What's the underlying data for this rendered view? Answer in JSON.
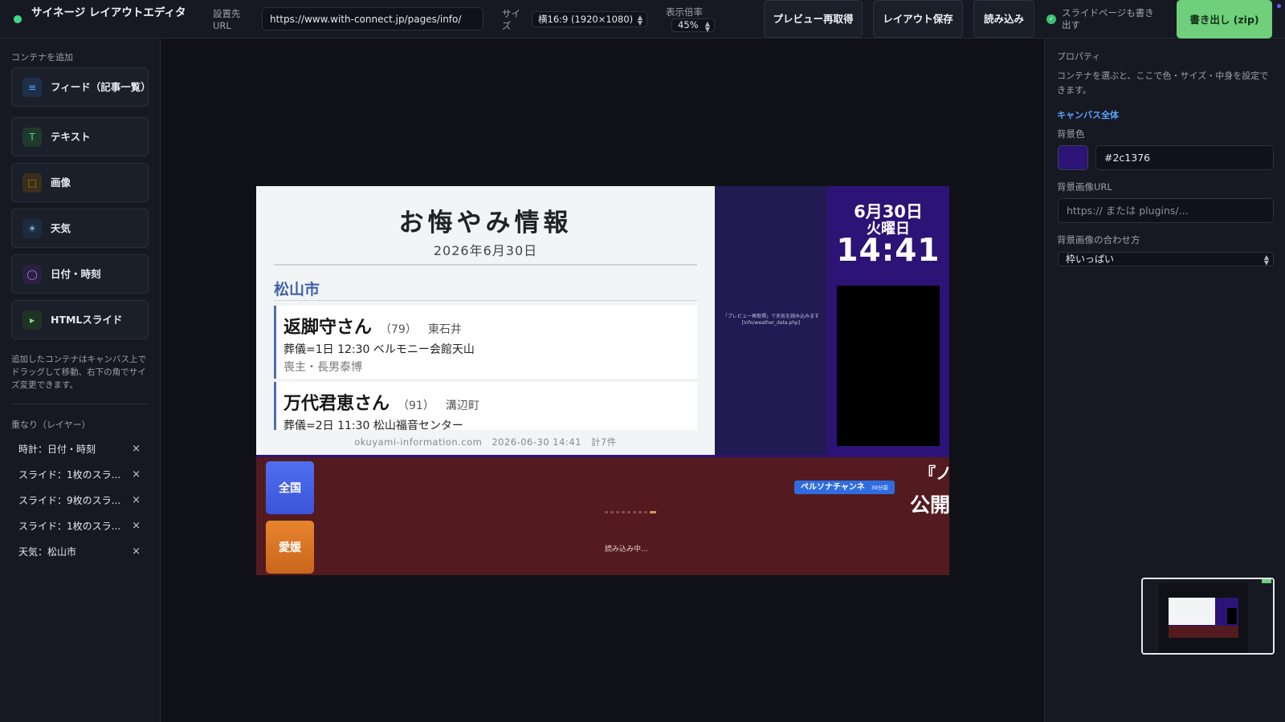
{
  "app": {
    "title": "サイネージ レイアウトエディタ"
  },
  "toolbar": {
    "url_label": "設置先URL",
    "url_value": "https://www.with-connect.jp/pages/info/",
    "size_label": "サイズ",
    "size_value": "横16:9 (1920×1080)",
    "zoom_label": "表示倍率",
    "zoom_value": "45%",
    "preview_button": "プレビュー再取得",
    "save_button": "レイアウト保存",
    "load_button": "読み込み",
    "slide_export_checkbox": "スライドページも書き出す",
    "slide_export_checked": true,
    "export_button": "書き出し (zip)"
  },
  "sidebar": {
    "add_title": "コンテナを追加",
    "add_items": [
      {
        "label": "フィード（記事一覧）",
        "icon": "list-icon",
        "glyph": "≡",
        "color": "#5aa3ff",
        "bg": "#1f2f4a"
      },
      {
        "label": "テキスト",
        "icon": "text-icon",
        "glyph": "T",
        "color": "#5cd08a",
        "bg": "#1d3a2a"
      },
      {
        "label": "画像",
        "icon": "image-icon",
        "glyph": "⬚",
        "color": "#f2b13a",
        "bg": "#3a2f1a"
      },
      {
        "label": "天気",
        "icon": "sun-icon",
        "glyph": "☀",
        "color": "#7fc8ff",
        "bg": "#1e2a3e"
      },
      {
        "label": "日付・時刻",
        "icon": "clock-icon",
        "glyph": "◯",
        "color": "#b07cff",
        "bg": "#2a2140"
      },
      {
        "label": "HTMLスライド",
        "icon": "play-icon",
        "glyph": "▸",
        "color": "#7ee08a",
        "bg": "#1f3324"
      }
    ],
    "help_text": "追加したコンテナはキャンバス上でドラッグして移動、右下の角でサイズ変更できます。",
    "layers_title": "重なり（レイヤー）",
    "layers": [
      "時計：日付・時刻",
      "スライド：1枚のスラ...",
      "スライド：9枚のスラ...",
      "スライド：1枚のスラ...",
      "天気：松山市"
    ]
  },
  "properties": {
    "title": "プロパティ",
    "help": "コンテナを選ぶと、ここで色・サイズ・中身を設定できます。",
    "section": "キャンバス全体",
    "bg_color_label": "背景色",
    "bg_color_value": "#2c1376",
    "bg_image_url_label": "背景画像URL",
    "bg_image_url_placeholder": "https:// または plugins/...",
    "bg_fit_label": "背景画像の合わせ方",
    "bg_fit_value": "枠いっぱい"
  },
  "canvas": {
    "feed": {
      "title": "お悔やみ情報",
      "date": "2026年6月30日",
      "city": "松山市",
      "entries": [
        {
          "name": "返脚守さん",
          "age": "（79）",
          "area": "東石井",
          "line1": "葬儀=1日 12:30 ベルモニー会館天山",
          "line2": "喪主・長男泰博"
        },
        {
          "name": "万代君恵さん",
          "age": "（91）",
          "area": "溝辺町",
          "line1": "葬儀=2日 11:30 松山福音センター",
          "line2": ""
        }
      ],
      "footer": "okuyami-information.com　2026-06-30 14:41　計7件"
    },
    "weather_message": "「プレビュー再取得」で天気を読み込みます [info/weather_data.php]",
    "clock": {
      "date": "6月30日",
      "weekday": "火曜日",
      "time": "14:41"
    },
    "slides": {
      "badge_national": "全国",
      "badge_local": "愛媛",
      "loading": "読み込み中...",
      "channel": "ペルソナチャンネ",
      "channel_time": "39分前",
      "cut_title_1": "『ノ",
      "cut_title_2": "公開",
      "dot_count": 9,
      "active_dot": 8
    }
  },
  "colors": {
    "canvas_bg": "#2c1376",
    "accent_green": "#6fcf7a",
    "feed_accent": "#4a6fb5"
  }
}
